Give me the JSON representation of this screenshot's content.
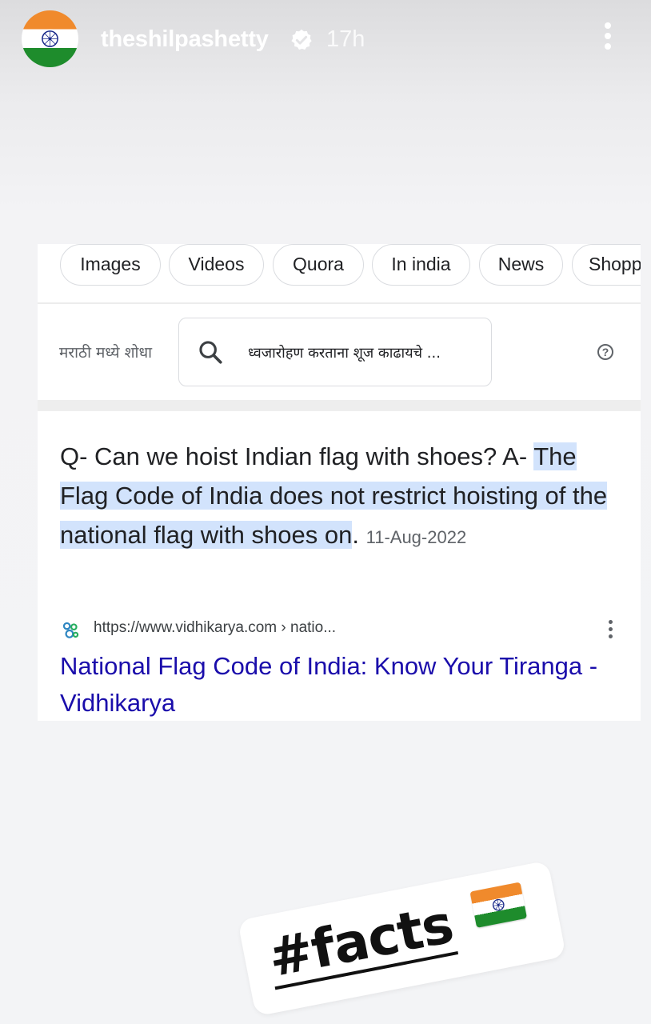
{
  "story": {
    "username": "theshilpashetty",
    "time": "17h",
    "avatar_icon": "indian-flag-icon",
    "verified_icon": "verified-badge-icon",
    "more_icon": "more-vertical-icon"
  },
  "search": {
    "chips": [
      "Images",
      "Videos",
      "Quora",
      "In india",
      "News",
      "Shopp"
    ],
    "language_label": "मराठी मध्ये शोधा",
    "query_suggestion": "ध्वजारोहण करताना शूज काढायचे ...",
    "search_icon": "search-icon",
    "help_icon": "help-circle-icon"
  },
  "snippet": {
    "question": "Q- Can we hoist Indian flag with shoes? A-",
    "answer_highlight": "The Flag Code of India does not restrict hoisting of the national flag with shoes on",
    "answer_end": ".",
    "date": "11-Aug-2022"
  },
  "result": {
    "url": "https://www.vidhikarya.com › natio...",
    "title": "National Flag Code of India: Know Your Tiranga - Vidhikarya",
    "more_icon": "more-vertical-icon"
  },
  "sticker": {
    "hashtag": "#facts",
    "emoji": "indian-flag-emoji"
  },
  "colors": {
    "link_title": "#1a0dab",
    "highlight": "#d2e3fc",
    "saffron": "#f08a2c",
    "green": "#1e8c2c"
  }
}
